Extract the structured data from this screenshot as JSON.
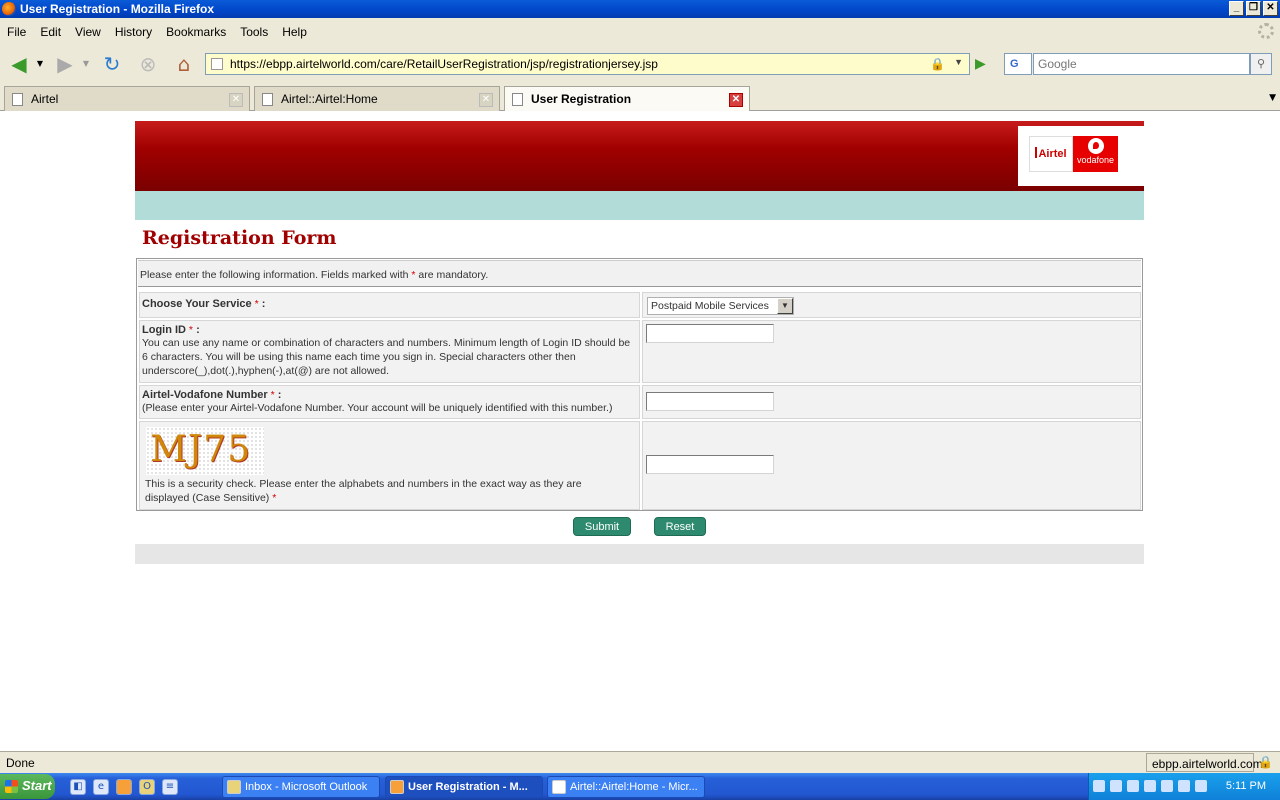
{
  "window": {
    "title": "User Registration - Mozilla Firefox"
  },
  "menu": [
    "File",
    "Edit",
    "View",
    "History",
    "Bookmarks",
    "Tools",
    "Help"
  ],
  "nav": {
    "url": "https://ebpp.airtelworld.com/care/RetailUserRegistration/jsp/registrationjersey.jsp",
    "search_placeholder": "Google"
  },
  "tabs": [
    {
      "label": "Airtel"
    },
    {
      "label": "Airtel::Airtel:Home"
    },
    {
      "label": "User Registration"
    }
  ],
  "header": {
    "logo_airtel": "Airtel",
    "logo_vodafone": "vodafone"
  },
  "form": {
    "title": "Registration Form",
    "info_pre": "Please enter the following information. Fields marked with ",
    "info_star": "*",
    "info_post": " are mandatory.",
    "service_label": "Choose Your Service",
    "service_value": "Postpaid Mobile Services",
    "login_label": "Login ID",
    "login_desc": "You can use any name or combination of characters and numbers. Minimum length of Login ID should be 6 characters. You will be using this name each time you sign in. Special characters other then underscore(_),dot(.),hyphen(-),at(@) are not allowed.",
    "number_label": "Airtel-Vodafone Number",
    "number_desc": "(Please enter your Airtel-Vodafone Number. Your account will be uniquely identified with this number.)",
    "captcha_text": "MJ75",
    "captcha_desc": "This is a security check. Please enter the alphabets and numbers in the exact way as they are displayed (Case Sensitive)",
    "star": "*",
    "colon": " :",
    "submit": "Submit",
    "reset": "Reset"
  },
  "status": {
    "text": "Done",
    "host": "ebpp.airtelworld.com"
  },
  "taskbar": {
    "start": "Start",
    "tasks": [
      "Inbox - Microsoft Outlook",
      "User Registration - M...",
      "Airtel::Airtel:Home - Micr..."
    ],
    "clock": "5:11 PM"
  },
  "colors": {
    "banner_red": "#a00000",
    "teal_strip": "#b1dcd8",
    "button_teal": "#2e8a6e",
    "title_red": "#a00000"
  }
}
